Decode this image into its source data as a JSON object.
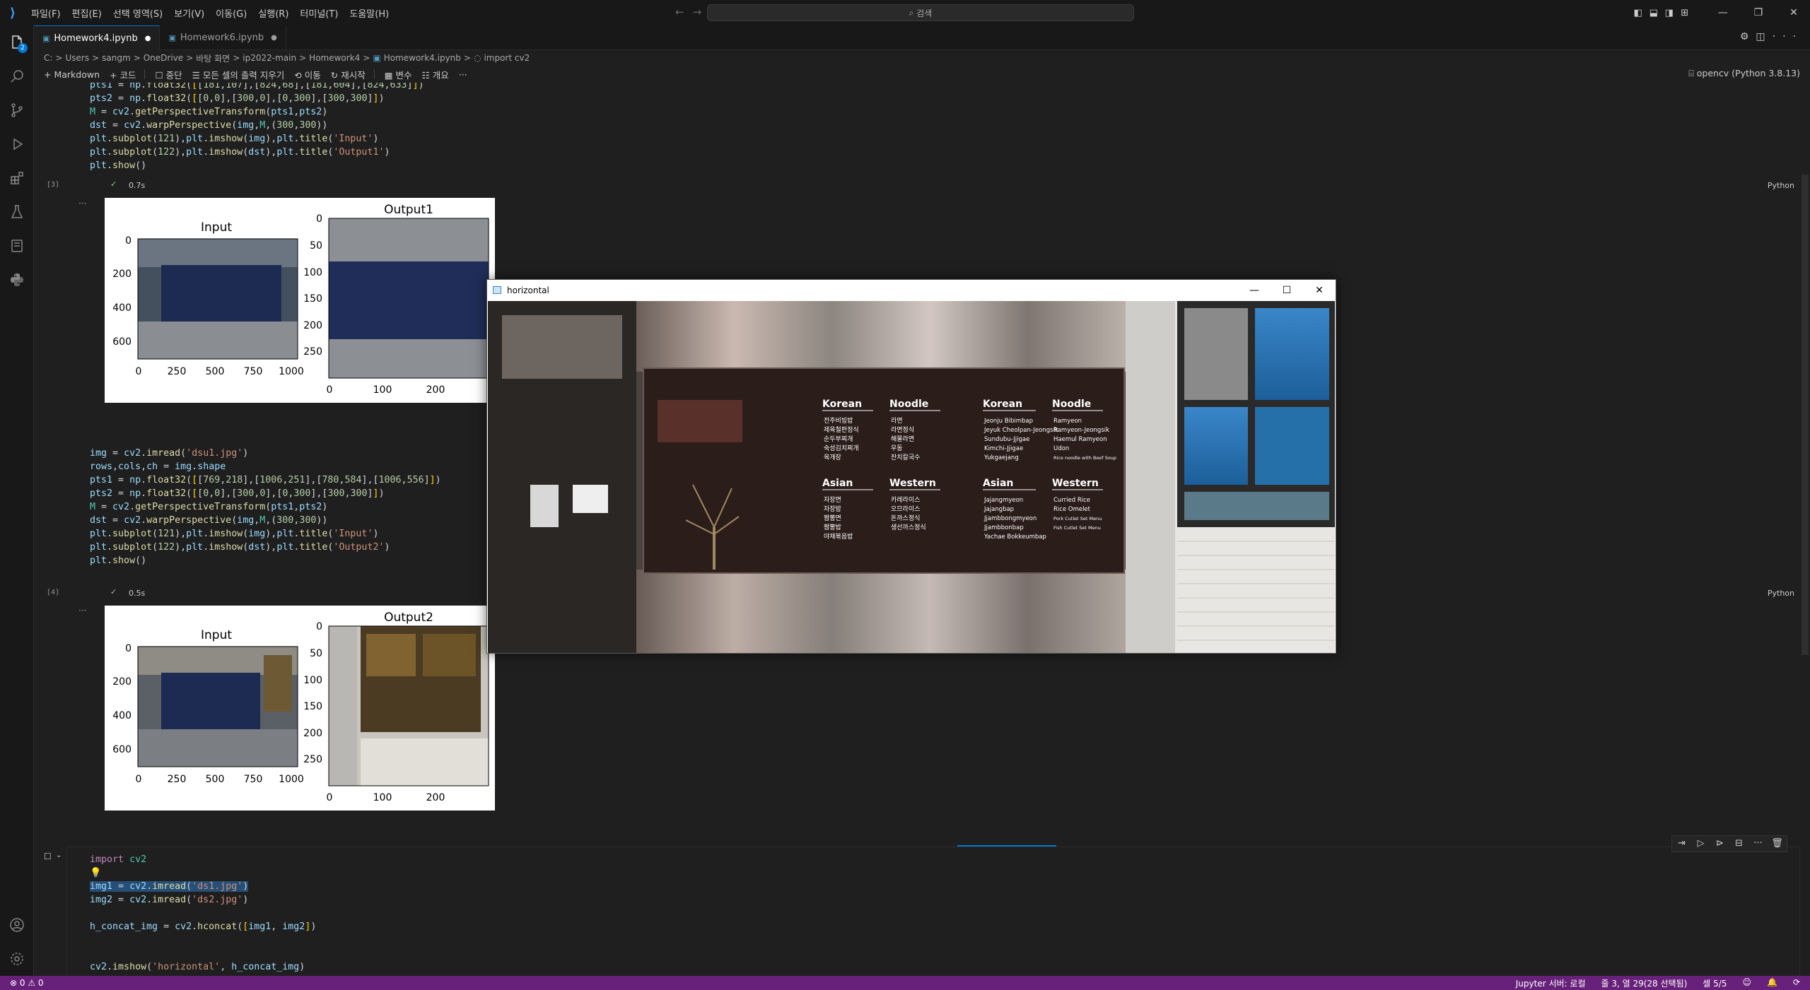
{
  "titlebar": {
    "menu": [
      "파일(F)",
      "편집(E)",
      "선택 영역(S)",
      "보기(V)",
      "이동(G)",
      "실행(R)",
      "터미널(T)",
      "도움말(H)"
    ],
    "search_placeholder": "검색"
  },
  "activity_badge": "2",
  "tabs": [
    {
      "label": "Homework4.ipynb",
      "modified": "●"
    },
    {
      "label": "Homework6.ipynb",
      "modified": "●"
    }
  ],
  "breadcrumb": [
    "C:",
    ">",
    "Users",
    ">",
    "sangm",
    ">",
    "OneDrive",
    ">",
    "바탕 화면",
    ">",
    "ip2022-main",
    ">",
    "Homework4",
    ">",
    "Homework4.ipynb",
    ">",
    "import cv2"
  ],
  "toolbar": {
    "markdown": "+ Markdown",
    "code": "+ 코드",
    "stop": "중단",
    "clear": "모든 셀의 출력 지우기",
    "goto": "이동",
    "restart": "재시작",
    "variables": "변수",
    "outline": "개요",
    "more": "···",
    "kernel": "opencv (Python 3.8.13)"
  },
  "cell3": {
    "exec": "[3]",
    "time": "0.7s",
    "lang": "Python",
    "plot": {
      "left_title": "Input",
      "right_title": "Output1",
      "left_yticks": [
        "0",
        "200",
        "400",
        "600"
      ],
      "left_xticks": [
        "0",
        "250",
        "500",
        "750",
        "1000"
      ],
      "right_yticks": [
        "0",
        "50",
        "100",
        "150",
        "200",
        "250"
      ],
      "right_xticks": [
        "0",
        "100",
        "200"
      ]
    }
  },
  "cell4": {
    "exec": "[4]",
    "time": "0.5s",
    "lang": "Python",
    "plot": {
      "left_title": "Input",
      "right_title": "Output2",
      "left_yticks": [
        "0",
        "200",
        "400",
        "600"
      ],
      "left_xticks": [
        "0",
        "250",
        "500",
        "750",
        "1000"
      ],
      "right_yticks": [
        "0",
        "50",
        "100",
        "150",
        "200",
        "250"
      ],
      "right_xticks": [
        "0",
        "100",
        "200"
      ]
    }
  },
  "popup": {
    "title": "horizontal"
  },
  "menu_board": {
    "left": {
      "korean": "Korean",
      "noodle": "Noodle",
      "asian": "Asian",
      "western": "Western",
      "k_items": [
        "전주비빔밥",
        "제육철판정식",
        "순두부찌개",
        "숙성김치찌개",
        "육개장"
      ],
      "n_items": [
        "라면",
        "라면정식",
        "해물라면",
        "우동",
        "잔치칼국수"
      ],
      "a_items": [
        "자장면",
        "자장밥",
        "짬뽕면",
        "짬뽕밥",
        "야채볶음밥"
      ],
      "w_items": [
        "카레라이스",
        "오므라이스",
        "돈까스정식",
        "생선까스정식"
      ]
    },
    "right": {
      "korean": "Korean",
      "noodle": "Noodle",
      "asian": "Asian",
      "western": "Western",
      "k_items": [
        "Jeonju Bibimbap",
        "Jeyuk Cheolpan-Jeongsik",
        "Sundubu-Jjigae",
        "Kimchi-Jjigae",
        "Yukgaejang"
      ],
      "n_items": [
        "Ramyeon",
        "Ramyeon-Jeongsik",
        "Haemul Ramyeon",
        "Udon",
        "Rice noodle with Beef Soup"
      ],
      "a_items": [
        "Jajangmyeon",
        "Jajangbap",
        "Jjambbongmyeon",
        "Jjambbonbap",
        "Yachae Bokkeumbap"
      ],
      "w_items": [
        "Curried Rice",
        "Rice Omelet",
        "Pork Cutlet Set Menu",
        "Fish Cutlet Set Menu"
      ]
    }
  },
  "statusbar": {
    "problems": "⊗ 0 ⚠ 0",
    "jupyter": "Jupyter 서버: 로컬",
    "position": "줄 3, 열 29(28 선택됨)",
    "cell": "셀 5/5"
  }
}
